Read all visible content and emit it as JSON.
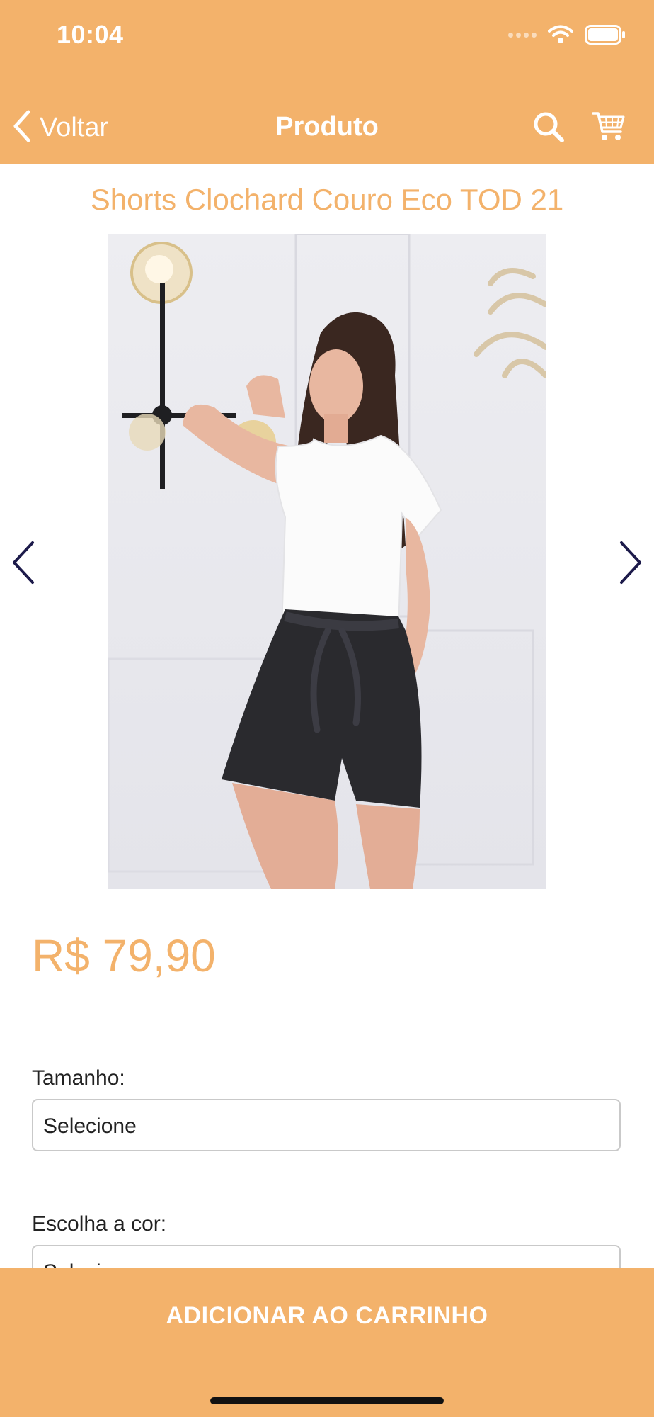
{
  "status_bar": {
    "time": "10:04"
  },
  "navbar": {
    "back_label": "Voltar",
    "title": "Produto",
    "icons": [
      "chevron-left-icon",
      "search-icon",
      "cart-icon"
    ]
  },
  "product": {
    "title": "Shorts Clochard Couro Eco TOD 21",
    "price": "R$ 79,90"
  },
  "options": {
    "size_label": "Tamanho:",
    "size_value": "Selecione",
    "color_label": "Escolha a cor:",
    "color_value": "Selecione"
  },
  "cta": {
    "label": "ADICIONAR AO CARRINHO"
  },
  "colors": {
    "accent": "#f3b26b",
    "arrow": "#1c1a4a"
  }
}
